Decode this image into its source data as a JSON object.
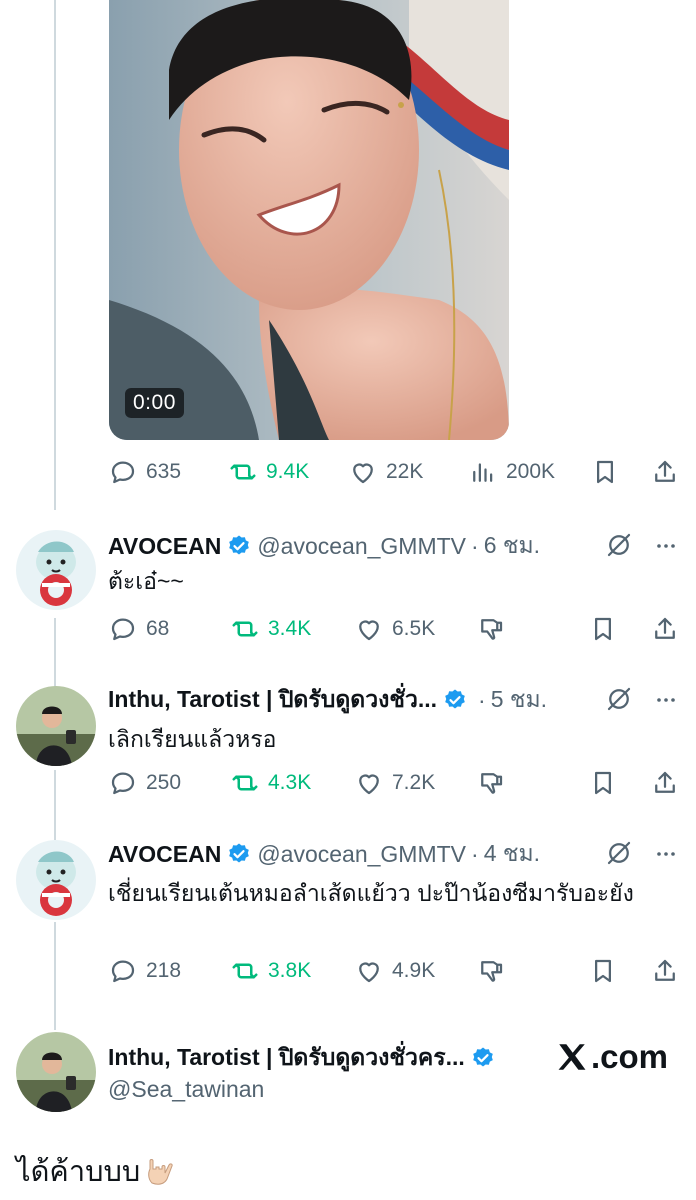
{
  "main_tweet": {
    "video_timestamp": "0:00",
    "stats": {
      "replies": "635",
      "retweets": "9.4K",
      "likes": "22K",
      "views": "200K"
    }
  },
  "replies": [
    {
      "name": "AVOCEAN",
      "handle": "@avocean_GMMTV",
      "separator": "·",
      "time": "6 ชม.",
      "text": "ต้ะเอ๋~~",
      "stats": {
        "replies": "68",
        "retweets": "3.4K",
        "likes": "6.5K"
      }
    },
    {
      "name": "Inthu, Tarotist | ปิดรับดูดวงชั่ว...",
      "handle": "",
      "separator": "·",
      "time": "5 ชม.",
      "text": "เลิกเรียนแล้วหรอ",
      "stats": {
        "replies": "250",
        "retweets": "4.3K",
        "likes": "7.2K"
      }
    },
    {
      "name": "AVOCEAN",
      "handle": "@avocean_GMMTV",
      "separator": "·",
      "time": "4 ชม.",
      "text": "เชี่ยนเรียนเต้นหมอลำเส้ดแย้วว ปะป๊าน้องซีมารับอะยัง",
      "stats": {
        "replies": "218",
        "retweets": "3.8K",
        "likes": "4.9K"
      }
    }
  ],
  "footer": {
    "name": "Inthu, Tarotist | ปิดรับดูดวงชั่วคร...",
    "handle": "@Sea_tawinan",
    "brand": ".com"
  },
  "caption": "ได้ค้าบบบ",
  "colors": {
    "accent_blue": "#1d9bf0",
    "retweet_green": "#00ba7c",
    "text_secondary": "#536471",
    "thread_line": "#cfd9de"
  }
}
